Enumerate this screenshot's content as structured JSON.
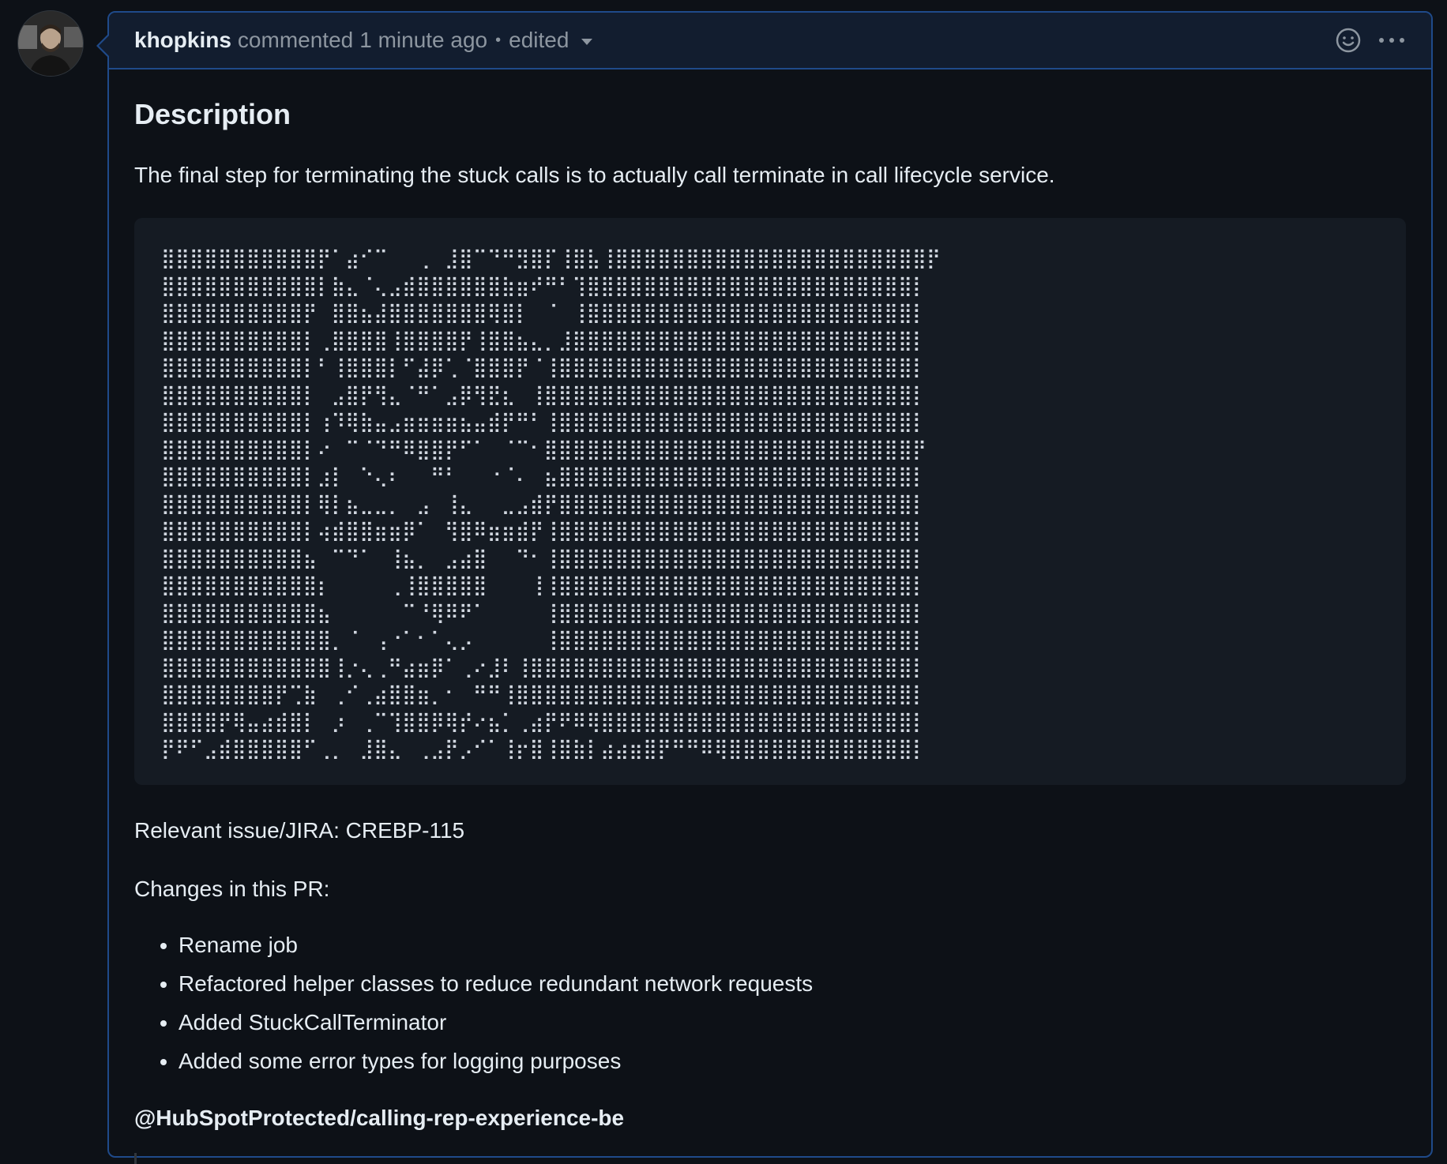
{
  "comment": {
    "author": "khopkins",
    "action": "commented",
    "time": "1 minute ago",
    "separator": "•",
    "edited_label": "edited"
  },
  "body": {
    "heading": "Description",
    "intro": "The final step for terminating the stuck calls is to actually call terminate in call lifecycle service.",
    "code_art": "⣿⣿⣿⣿⣿⣿⣿⣿⣿⣿⣿⡟⠁⣴⠊⠉⠀⠀⢀⠀⣸⣿⠉⠙⠛⣻⣿⡏⢸⣿⣧⢸⣿⣿⣿⣿⣿⣿⣿⣿⣿⣿⣿⣿⣿⣿⣿⣿⣿⣿⣿⣿⣿⣿⡟\n⣿⣿⣿⣿⣿⣿⣿⣿⣿⣿⣿⡇⣷⣄⠈⢄⣠⣾⣿⣿⣿⣿⣿⣿⣷⣶⠞⠛⠃⢹⣿⣿⣿⣿⣿⣿⣿⣿⣿⣿⣿⣿⣿⣿⣿⣿⣿⣿⣿⣿⣿⣿⣿⡇\n⣿⣿⣿⣿⣿⣿⣿⣿⣿⣿⡟⠀⣿⣿⣦⣼⣿⣿⣿⣿⣿⣿⣿⢿⣿⡇⠀⠈⠀⢸⣿⣿⣿⣿⣿⣿⣿⣿⣿⣿⣿⣿⣿⣿⣿⣿⣿⣿⣿⣿⣿⣿⣿⡇\n⣿⣿⣿⣿⣿⣿⣿⣿⣿⣿⡇⢀⣿⣿⣿⣿⢸⣿⣿⣿⣿⡟⢸⣿⣿⣦⣄⡀⣸⣿⣿⣿⣿⣿⣿⣿⣿⣿⣿⣿⣿⣿⣿⣿⣿⣿⣿⣿⣿⣿⣿⣿⣿⡇\n⣿⣿⣿⣿⣿⣿⣿⣿⣿⣿⡇⠃⢸⣿⣿⣿⡇⠋⣼⡿⢁⠈⣿⣿⣿⡟⠈⢸⣿⣿⣿⣿⣿⣿⣿⣿⣿⣿⣿⣿⣿⣿⣿⣿⣿⣿⣿⣿⣿⣿⣿⣿⣿⡇\n⣿⣿⣿⣿⣿⣿⣿⣿⣿⣿⡇⠀⣠⣿⡟⢻⣄⠈⠛⠁⣠⡿⢻⣟⣆⠀⢸⣿⣿⣿⣿⣿⣿⣿⣿⣿⣿⣿⣿⣿⣿⣿⣿⣿⣿⣿⣿⣿⣿⣿⣿⣿⣿⡇\n⣿⣿⣿⣿⣿⣿⣿⣿⣿⣿⡇⢰⠹⢿⣷⣤⣠⣶⣶⣶⣶⣦⣤⣾⡟⠛⠃⢸⣿⣿⣿⣿⣿⣿⣿⣿⣿⣿⣿⣿⣿⣿⣿⣿⣿⣿⣿⣿⣿⣿⣿⣿⣿⡇\n⣿⣿⣿⣿⣿⣿⣿⣿⣿⣿⡇⠔⠀⠉⠈⠙⠛⠿⣿⣿⡟⠋⠁⠀⠈⠉⠂⣿⣿⣿⣿⣿⣿⣿⣿⣿⣿⣿⣿⣿⣿⣿⣿⣿⣿⣿⣿⣿⣿⣿⣿⣿⣿⡟\n⣿⣿⣿⣿⣿⣿⣿⣿⣿⣿⡇⣰⡇⠀⠑⢄⠆⠀⠀⠛⠃⠀⠀⠐⠈⠄⠀⣦⣿⣿⣿⣿⣿⣿⣿⣿⣿⣿⣿⣿⣿⣿⣿⣿⣿⣿⣿⣿⣿⣿⣿⣿⣿⡇\n⣿⣿⣿⣿⣿⣿⣿⣿⣿⣿⡇⢿⡇⣦⣀⣀⡀⠀⣠⠀⢸⣄⠀⠀⣀⣠⣾⡟⣿⣿⣿⣿⣿⣿⣿⣿⣿⣿⣿⣿⣿⣿⣿⣿⣿⣿⣿⣿⣿⣿⣿⣿⣿⡇\n⣿⣿⣿⣿⣿⣿⣿⣿⣿⣿⡇⢴⣾⣿⣿⣶⣶⡿⠁⠀⢻⣿⠿⣶⣶⣾⡟⢸⣿⣿⣿⣿⣿⣿⣿⣿⣿⣿⣿⣿⣿⣿⣿⣿⣿⣿⣿⣿⣿⣿⣿⣿⣿⡇\n⣿⣿⣿⣿⣿⣿⣿⣿⣿⣿⣦⠀⠉⠙⠁⠀⢸⣦⡀⠀⣠⣴⣿⠀⠀⠙⠂⢸⣿⣿⣿⣿⣿⣿⣿⣿⣿⣿⣿⣿⣿⣿⣿⣿⣿⣿⣿⣿⣿⣿⣿⣿⣿⡇\n⣿⣿⣿⣿⣿⣿⣿⣿⣿⣿⣿⡆⠀⠀⠀⠀⢀⢸⣿⣿⣿⣿⣿⠀⠀⠀⢸⢸⣿⣿⣿⣿⣿⣿⣿⣿⣿⣿⣿⣿⣿⣿⣿⣿⣿⣿⣿⣿⣿⣿⣿⣿⣿⡇\n⣿⣿⣿⣿⣿⣿⣿⣿⣿⣿⣿⣦⠀⠀⠀⠀⠀⠉⠘⢿⠿⠟⠁⠀⠀⠀⠀⢸⣿⣿⣿⣿⣿⣿⣿⣿⣿⣿⣿⣿⣿⣿⣿⣿⣿⣿⣿⣿⣿⣿⣿⣿⣿⡇\n⣿⣿⣿⣿⣿⣿⣿⣿⣿⣿⣿⣿⡀⠈⠀⢠⠐⠁⠂⠁⢄⡠⠀⠀⠀⠀⠀⢸⣿⣿⣿⣿⣿⣿⣿⣿⣿⣿⣿⣿⣿⣿⣿⣿⣿⣿⣿⣿⣿⣿⣿⣿⣿⡇\n⣿⣿⣿⣿⣿⣿⣿⣿⣿⣿⣿⣿⢸⡐⢄⢀⠛⣴⣶⡿⠁⢀⠔⣸⠇⢸⣿⣿⣿⣿⣿⣿⣿⣿⣿⣿⣿⣿⣿⣿⣿⣿⣿⣿⣿⣿⣿⣿⣿⣿⣿⣿⣿⡇\n⣿⣿⣿⣿⣿⣿⣿⣿⡟⢉⣷⠀⢀⠊⢀⣴⣿⣿⣶⡀⠂⠀⠛⠛⢸⣿⣿⣿⣿⣿⣿⣿⣿⣿⣿⣿⣿⣿⣿⣿⣿⣿⣿⣿⣿⣿⣿⣿⣿⣿⣿⣿⣿⡇\n⣿⣿⣿⣿⡟⢿⣤⣴⣾⣿⡇⠀⡰⠀⢀⠉⢹⣿⣿⡿⢿⡞⠔⣦⡁⢀⣴⡟⠟⠿⢿⣿⣿⣿⣿⣿⣿⣿⣿⣿⣿⣿⣿⣿⣿⣿⣿⣿⣿⣿⣿⣿⣿⡇\n⡟⠟⠋⣠⣾⣿⣿⣿⣿⣿⠋⢀⡀⠀⣸⣿⣄⠀⢀⣠⡟⡠⠊⠁⢸⡖⣿⢸⣿⣷⡇⣴⣴⣶⣿⡟⠛⠛⠿⢿⣿⣿⣿⣿⣿⣿⣿⣿⣿⣿⣿⣿⣿⡇",
    "relevant": "Relevant issue/JIRA: CREBP-115",
    "changes_heading": "Changes in this PR:",
    "changes": [
      "Rename job",
      "Refactored helper classes to reduce redundant network requests",
      "Added StuckCallTerminator",
      "Added some error types for logging purposes"
    ],
    "mention": "@HubSpotProtected/calling-rep-experience-be"
  }
}
